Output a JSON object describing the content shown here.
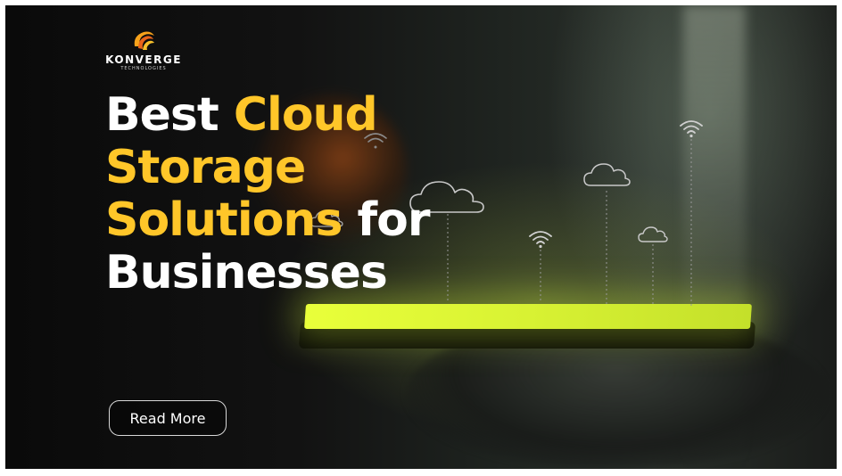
{
  "brand": {
    "name": "KONVERGE",
    "sub": "TECHNOLOGIES",
    "logo_icon": "swirl-logo-icon",
    "logo_colors": [
      "#f7a21b",
      "#e8641a"
    ]
  },
  "headline": {
    "line1_white": "Best ",
    "line1_accent": "Cloud",
    "line2_accent": "Storage",
    "line3_accent": "Solutions",
    "line3_white": " for",
    "line4_white": "Businesses"
  },
  "cta": {
    "label": "Read More"
  },
  "colors": {
    "accent": "#ffc629",
    "text": "#ffffff",
    "screen_glow": "#e9ff3a",
    "background": "#0a0a0a"
  },
  "decorations": [
    "cloud-icon",
    "wifi-icon"
  ]
}
